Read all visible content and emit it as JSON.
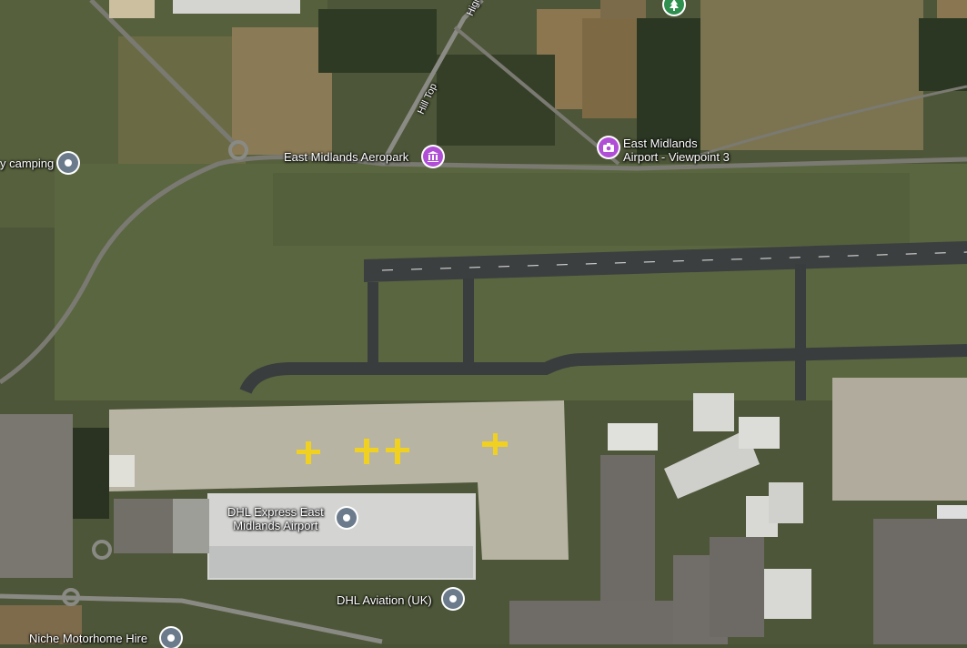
{
  "map": {
    "pois": [
      {
        "id": "aeropark",
        "label": "East Midlands Aeropark",
        "category": "museum",
        "icon": "museum-icon",
        "color": "#b04fd6"
      },
      {
        "id": "viewpoint",
        "label": "East Midlands\nAirport - Viewpoint 3",
        "category": "viewpoint",
        "icon": "camera-icon",
        "color": "#b04fd6"
      },
      {
        "id": "camping",
        "label": "y camping",
        "category": "place",
        "icon": "pin-dot-icon",
        "color": "#6b7b8c"
      },
      {
        "id": "dhl-express",
        "label": "DHL Express East\nMidlands Airport",
        "category": "place",
        "icon": "pin-dot-icon",
        "color": "#6b7b8c"
      },
      {
        "id": "dhl-aviation",
        "label": "DHL Aviation (UK)",
        "category": "place",
        "icon": "pin-dot-icon",
        "color": "#6b7b8c"
      },
      {
        "id": "niche",
        "label": "Niche Motorhome Hire",
        "category": "place",
        "icon": "pin-dot-icon",
        "color": "#6b7b8c"
      },
      {
        "id": "park",
        "label": "",
        "category": "park",
        "icon": "tree-icon",
        "color": "#2e8f4e"
      }
    ],
    "roads": [
      {
        "name": "Hill Top"
      },
      {
        "name": "High"
      }
    ]
  }
}
